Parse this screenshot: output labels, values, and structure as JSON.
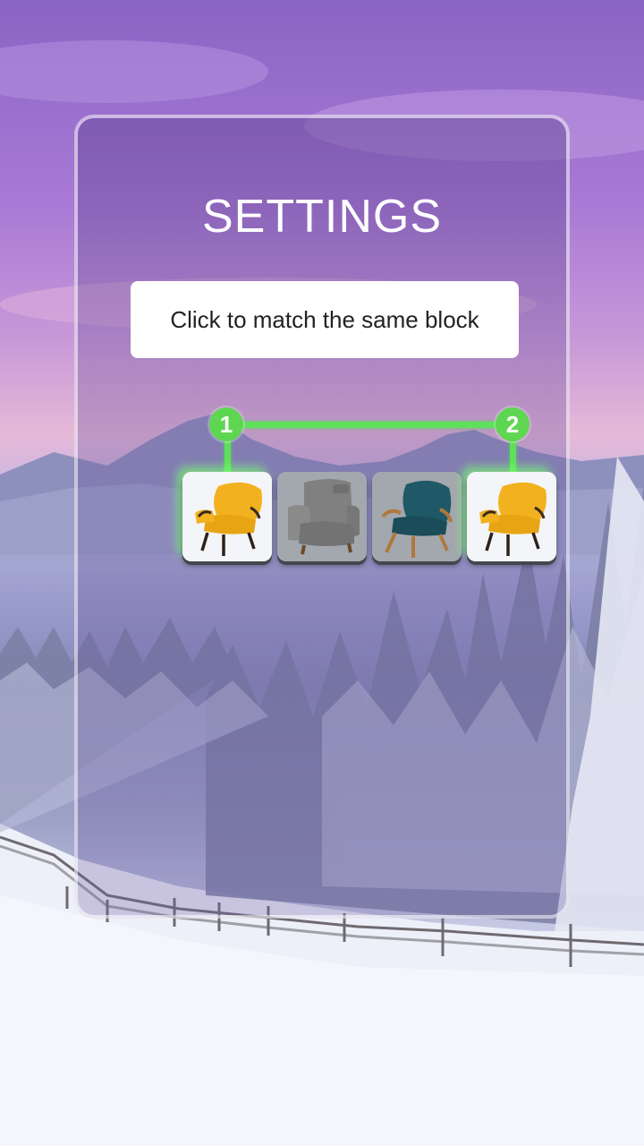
{
  "title": "SETTINGS",
  "hint": "Click to match the same block",
  "tiles": [
    {
      "item": "yellow-armchair-icon",
      "selected": true
    },
    {
      "item": "gray-armchair-icon",
      "selected": false
    },
    {
      "item": "teal-armchair-icon",
      "selected": false
    },
    {
      "item": "yellow-armchair-icon",
      "selected": true
    }
  ],
  "markers": [
    {
      "label": "1"
    },
    {
      "label": "2"
    }
  ],
  "colors": {
    "match_path": "#5ee05a",
    "marker": "#5fd652",
    "yellow_chair": "#f2b21f",
    "gray_chair": "#7d7d7d",
    "teal_chair": "#1f5866"
  }
}
